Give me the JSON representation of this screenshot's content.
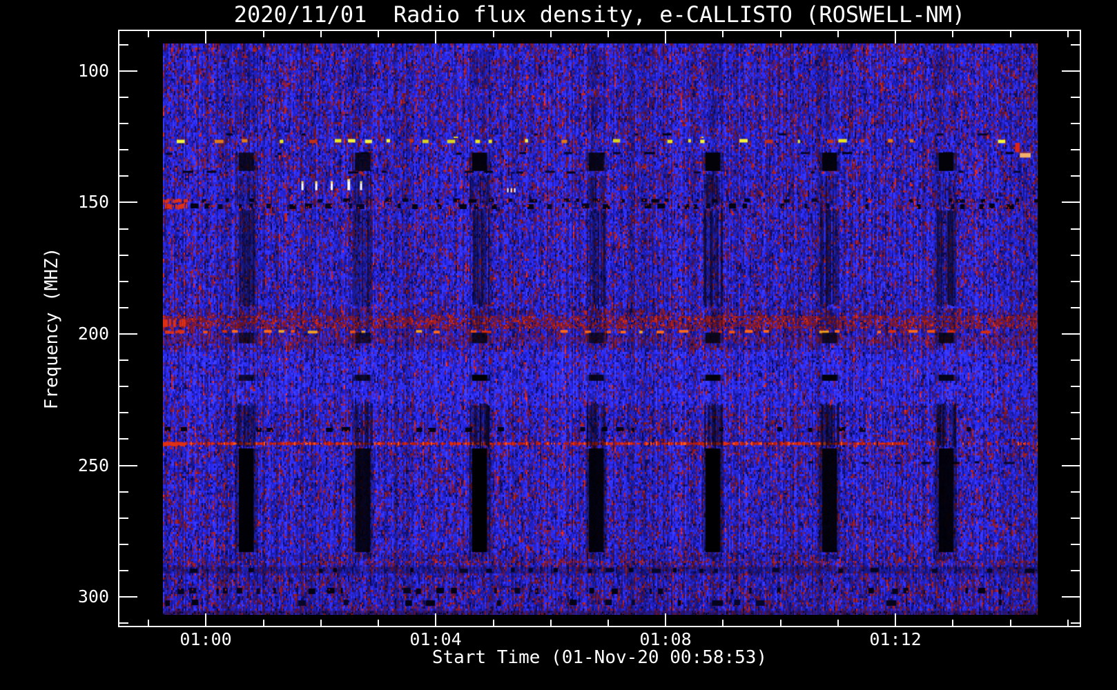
{
  "title": "2020/11/01  Radio flux density, e-CALLISTO (ROSWELL-NM)",
  "chart_data": {
    "type": "heatmap",
    "subtype": "radio-spectrogram",
    "title": "2020/11/01  Radio flux density, e-CALLISTO (ROSWELL-NM)",
    "xlabel": "Start Time (01-Nov-20 00:58:53)",
    "ylabel": "Frequency (MHZ)",
    "x_ticks": [
      {
        "minute": 60,
        "label": "01:00"
      },
      {
        "minute": 64,
        "label": "01:04"
      },
      {
        "minute": 68,
        "label": "01:08"
      },
      {
        "minute": 72,
        "label": "01:12"
      }
    ],
    "x_minor_range_min": [
      59,
      75
    ],
    "x_axis_range_min": [
      58.47,
      75.23
    ],
    "y_ticks": [
      {
        "value": 100,
        "label": "100"
      },
      {
        "value": 150,
        "label": "150"
      },
      {
        "value": 200,
        "label": "200"
      },
      {
        "value": 250,
        "label": "250"
      },
      {
        "value": 300,
        "label": "300"
      }
    ],
    "y_minor_step_mhz": 10,
    "ylim": [
      84.3,
      311.5
    ],
    "y_axis_inverted": true,
    "grid": false,
    "legend": "none",
    "data_time_range_min": [
      59.25,
      74.47
    ],
    "data_freq_range_mhz": [
      89.5,
      306.8
    ],
    "palette": {
      "bright_blue": "#2e2eee",
      "mid_blue": "#2222cf",
      "dark_blue": "#16169a",
      "navy": "#0c0c5e",
      "purple": "#471a70",
      "maroon": "#6e163e",
      "red": "#a62020",
      "bright_red": "#e22c10",
      "orange": "#f07820",
      "yellow": "#e6e320",
      "white": "#ffffff",
      "frame": "#ffffff",
      "background": "#000000"
    },
    "background_bands": [
      {
        "f0": 89.5,
        "f1": 125,
        "red": 1.25,
        "bright": 1.0
      },
      {
        "f0": 125,
        "f1": 150,
        "red": 1.1,
        "bright": 1.0
      },
      {
        "f0": 150,
        "f1": 190,
        "red": 1.0,
        "bright": 1.0
      },
      {
        "f0": 190,
        "f1": 199,
        "red": 2.0,
        "bright": 0.95
      },
      {
        "f0": 199,
        "f1": 206,
        "red": 1.6,
        "bright": 0.95
      },
      {
        "f0": 206,
        "f1": 227,
        "red": 0.55,
        "bright": 1.08
      },
      {
        "f0": 227,
        "f1": 247,
        "red": 1.15,
        "bright": 1.0
      },
      {
        "f0": 247,
        "f1": 258,
        "red": 0.9,
        "bright": 1.0
      },
      {
        "f0": 258,
        "f1": 283,
        "red": 1.0,
        "bright": 1.0
      },
      {
        "f0": 283,
        "f1": 307,
        "red": 1.35,
        "bright": 0.92
      }
    ],
    "rfi_lines": [
      {
        "freq_mhz": 124.1,
        "style": "dark-dash",
        "height_mhz": 1.0,
        "density": 0.25
      },
      {
        "freq_mhz": 126.5,
        "style": "yellow-dash",
        "height_mhz": 1.4,
        "density": 0.5
      },
      {
        "freq_mhz": 131.2,
        "style": "dark-dash",
        "height_mhz": 1.0,
        "density": 0.3
      },
      {
        "freq_mhz": 136.0,
        "style": "red-speckle",
        "height_mhz": 0.8,
        "density": 0.3
      },
      {
        "freq_mhz": 138.3,
        "style": "dark-dash",
        "height_mhz": 0.9,
        "density": 0.3
      },
      {
        "freq_mhz": 149.1,
        "style": "dark-red-band",
        "height_mhz": 1.4,
        "density": 0.5,
        "left_bright": true
      },
      {
        "freq_mhz": 151.3,
        "style": "dark-red-band",
        "height_mhz": 1.9,
        "density": 0.7,
        "left_bright": true
      },
      {
        "freq_mhz": 159.6,
        "style": "red-speckle",
        "height_mhz": 0.8,
        "density": 0.25
      },
      {
        "freq_mhz": 195.5,
        "style": "red-band",
        "height_mhz": 4.8,
        "density": 0.55,
        "left_bright": true
      },
      {
        "freq_mhz": 199.0,
        "style": "orange-dash",
        "height_mhz": 1.1,
        "density": 0.5,
        "left_bright": true
      },
      {
        "freq_mhz": 202.1,
        "style": "red-diffuse",
        "height_mhz": 2.6,
        "density": 0.3
      },
      {
        "freq_mhz": 236.2,
        "style": "dark-red-band",
        "height_mhz": 1.6,
        "density": 0.4
      },
      {
        "freq_mhz": 241.7,
        "style": "red-line",
        "height_mhz": 1.3,
        "density": 0.85,
        "x_fade_min": 72.2,
        "left_bright": true
      },
      {
        "freq_mhz": 245.4,
        "style": "red-speckle",
        "height_mhz": 0.8,
        "density": 0.3
      },
      {
        "freq_mhz": 248.8,
        "style": "dark-dash",
        "height_mhz": 0.9,
        "density": 0.4,
        "x_range_min": [
          69.5,
          74.47
        ]
      },
      {
        "freq_mhz": 259.8,
        "style": "red-speckle",
        "height_mhz": 0.8,
        "density": 0.15
      },
      {
        "freq_mhz": 272.4,
        "style": "red-speckle",
        "height_mhz": 0.8,
        "density": 0.12
      },
      {
        "freq_mhz": 286.4,
        "style": "red-speckle",
        "height_mhz": 0.9,
        "density": 0.4
      },
      {
        "freq_mhz": 289.8,
        "style": "navy-band",
        "height_mhz": 2.8,
        "density": 0.35
      },
      {
        "freq_mhz": 297.6,
        "style": "dark-red-band",
        "height_mhz": 2.1,
        "density": 0.4
      },
      {
        "freq_mhz": 302.1,
        "style": "dark-dash",
        "height_mhz": 2.1,
        "density": 0.35
      },
      {
        "freq_mhz": 306.0,
        "style": "purple-row",
        "height_mhz": 1.4,
        "density": 0.4
      }
    ],
    "interference_columns": {
      "centers_min": [
        60.7,
        62.73,
        64.76,
        66.79,
        68.82,
        70.85,
        72.88
      ],
      "solid_width_min": 0.26,
      "segments": [
        {
          "f0": 91.5,
          "f1": 107,
          "alpha": 0.33,
          "style": "striped",
          "color": "#0d0d55"
        },
        {
          "f0": 109,
          "f1": 122,
          "alpha": 0.25,
          "style": "striped",
          "color": "#0d0d55"
        },
        {
          "f0": 131,
          "f1": 138,
          "alpha": 0.92,
          "style": "solid",
          "color": "#020208"
        },
        {
          "f0": 139,
          "f1": 152,
          "alpha": 0.5,
          "style": "striped",
          "color": "#05051a"
        },
        {
          "f0": 152,
          "f1": 190,
          "alpha": 0.62,
          "style": "striped",
          "color": "#05051a"
        },
        {
          "f0": 190,
          "f1": 199,
          "alpha": 0.3,
          "style": "striped",
          "color": "#05051a"
        },
        {
          "f0": 199.5,
          "f1": 203.5,
          "alpha": 0.75,
          "style": "solid",
          "color": "#020208"
        },
        {
          "f0": 215.5,
          "f1": 217.8,
          "alpha": 0.85,
          "style": "solid",
          "color": "#000005"
        },
        {
          "f0": 226,
          "f1": 243.5,
          "alpha": 0.68,
          "style": "striped",
          "color": "#03030f"
        },
        {
          "f0": 243.5,
          "f1": 283,
          "alpha": 0.97,
          "style": "solid",
          "color": "#000003"
        },
        {
          "f0": 283,
          "f1": 286.5,
          "alpha": 0.45,
          "style": "striped",
          "color": "#05051a"
        }
      ]
    },
    "events": [
      {
        "type": "white-burst",
        "t": 61.66,
        "f": 145.3
      },
      {
        "type": "white-burst",
        "t": 61.9,
        "f": 145.3
      },
      {
        "type": "white-burst",
        "t": 62.17,
        "f": 145.3
      },
      {
        "type": "white-burst",
        "t": 62.46,
        "f": 145.3,
        "big": true
      },
      {
        "type": "white-burst",
        "t": 62.68,
        "f": 145.3
      },
      {
        "type": "white-tick",
        "t": 65.24,
        "f": 145.6
      },
      {
        "type": "white-tick",
        "t": 65.3,
        "f": 145.6
      },
      {
        "type": "white-tick",
        "t": 65.36,
        "f": 145.6
      },
      {
        "type": "orange-patch",
        "t0": 74.16,
        "t1": 74.35,
        "f0": 131.2,
        "f1": 132.9
      },
      {
        "type": "red-mark",
        "t0": 74.08,
        "t1": 74.16,
        "f0": 127.3,
        "f1": 130.8
      }
    ]
  }
}
